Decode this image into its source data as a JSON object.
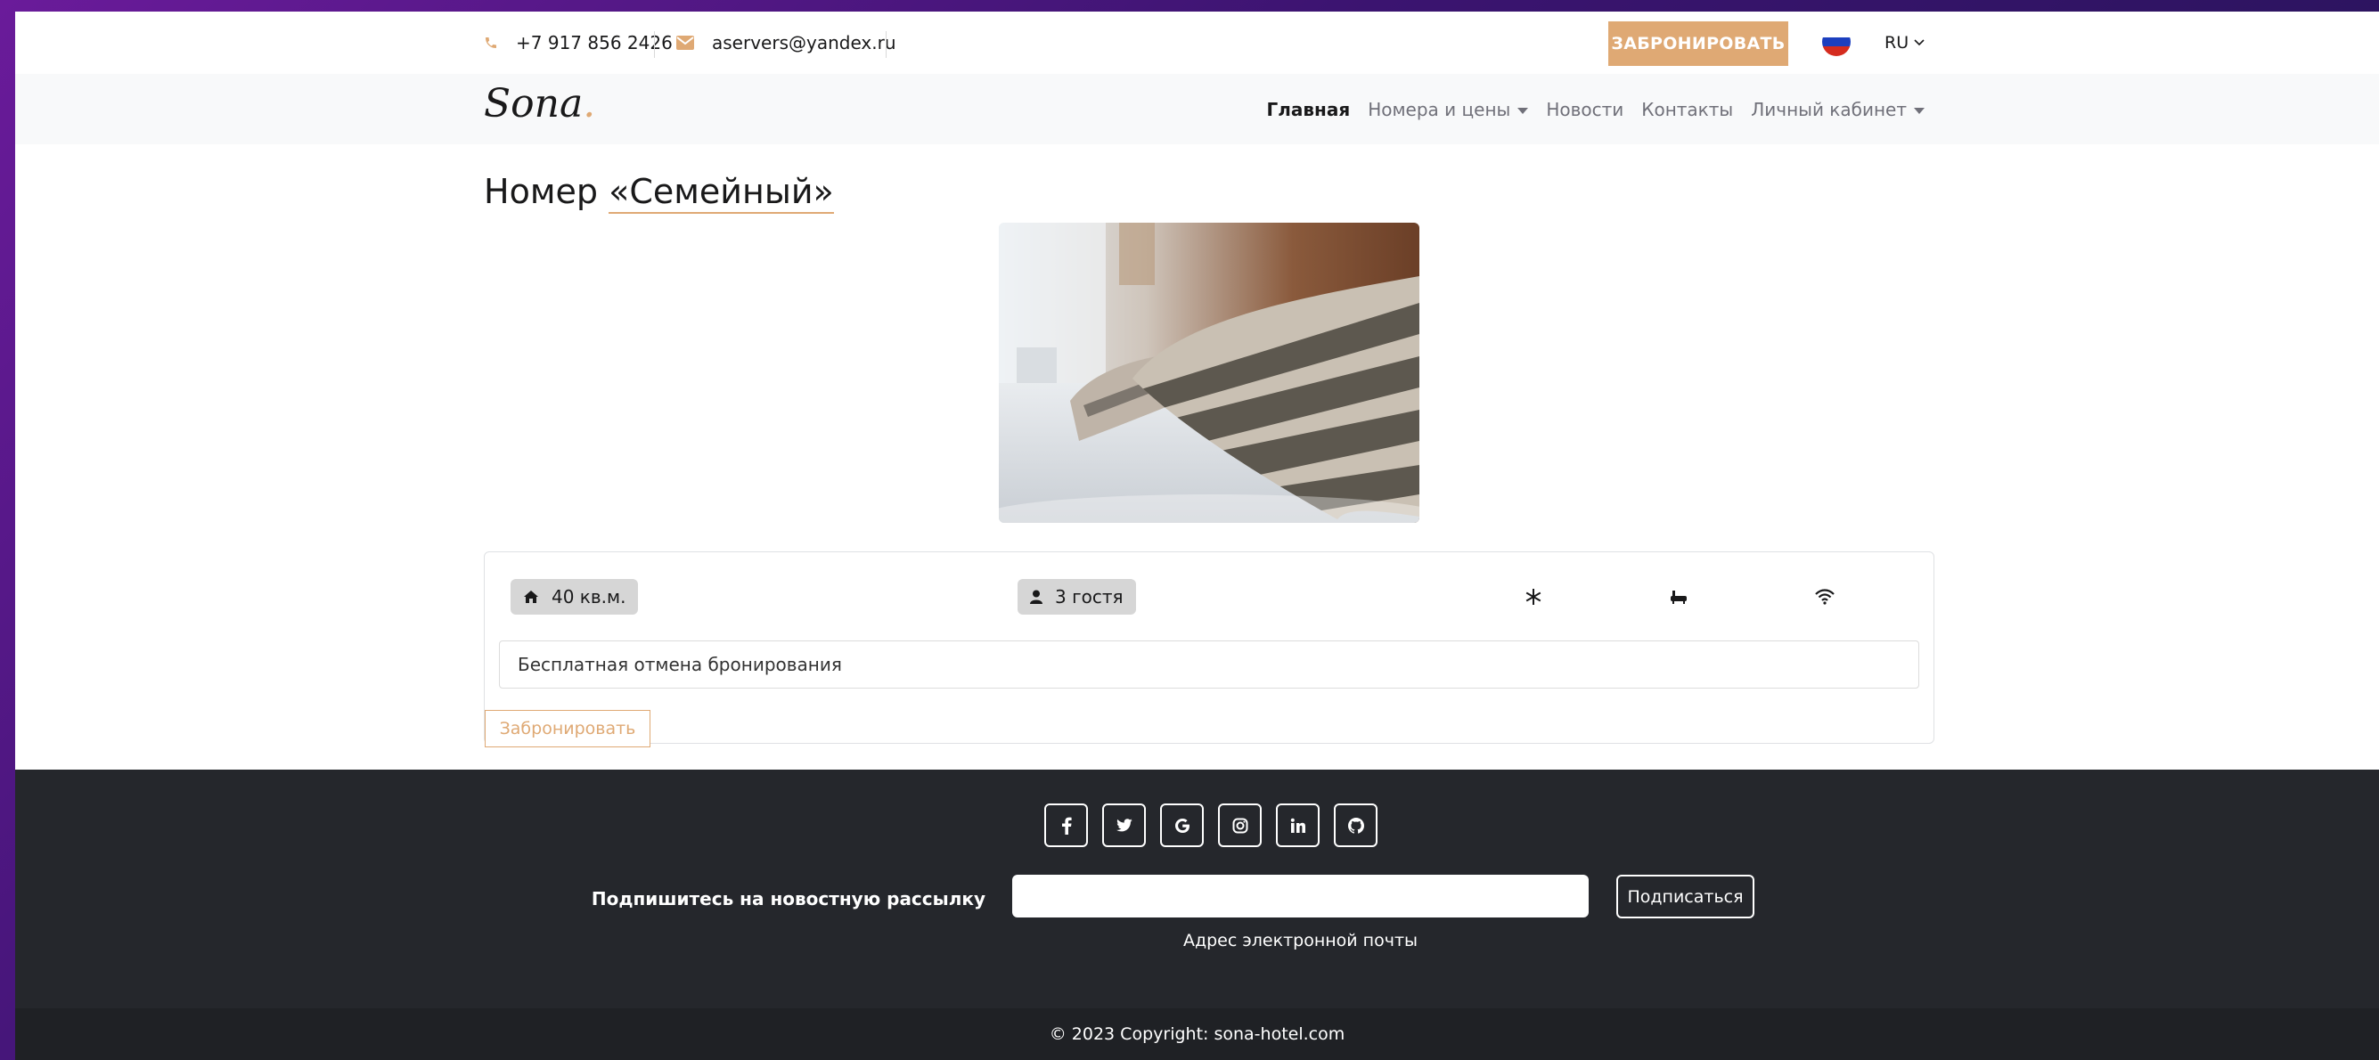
{
  "topbar": {
    "phone": "+7 917 856 2426",
    "email": "aservers@yandex.ru",
    "book_label": "ЗАБРОНИРОВАТЬ",
    "lang_label": "RU"
  },
  "navbar": {
    "logo": "Sona",
    "logo_dot": ".",
    "items": [
      {
        "label": "Главная"
      },
      {
        "label": "Номера и цены"
      },
      {
        "label": "Новости"
      },
      {
        "label": "Контакты"
      },
      {
        "label": "Личный кабинет"
      }
    ]
  },
  "room": {
    "title_prefix": "Номер ",
    "title_name": "«Семейный»",
    "area": "40 кв.м.",
    "guests": "3 гостя",
    "amenity_icons": [
      "snowflake-icon",
      "bath-icon",
      "wifi-icon"
    ],
    "description": "Бесплатная отмена бронирования",
    "book_label": "Забронировать"
  },
  "footer": {
    "socials": [
      {
        "name": "facebook",
        "glyph": "f"
      },
      {
        "name": "twitter",
        "glyph": "twitter"
      },
      {
        "name": "google",
        "glyph": "G"
      },
      {
        "name": "instagram",
        "glyph": "instagram"
      },
      {
        "name": "linkedin",
        "glyph": "in"
      },
      {
        "name": "github",
        "glyph": "github"
      }
    ],
    "newsletter_label": "Подпишитесь на новостную рассылку",
    "newsletter_input_value": "",
    "newsletter_help": "Адрес электронной почты",
    "subscribe_label": "Подписаться",
    "copyright": "© 2023 Copyright: sona-hotel.com"
  },
  "colors": {
    "accent": "#dfa974",
    "footer_bg": "#25272c"
  }
}
